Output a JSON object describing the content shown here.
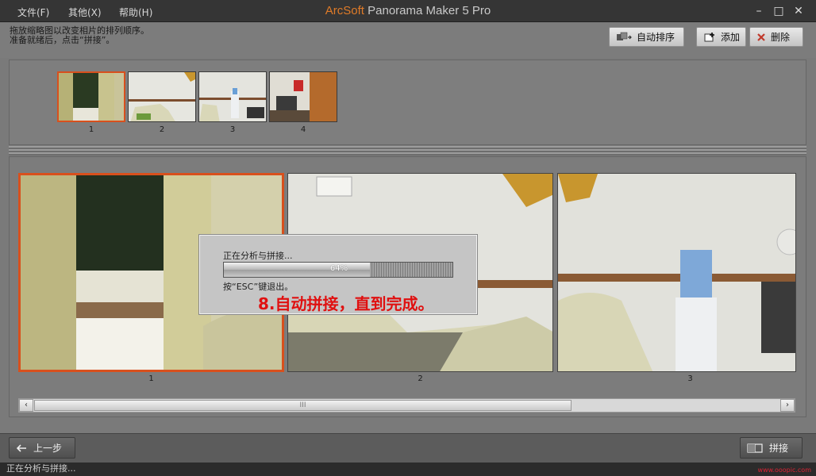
{
  "titlebar": {
    "menus": [
      "文件(F)",
      "其他(X)",
      "帮助(H)"
    ],
    "app_brand": "ArcSoft",
    "app_name": " Panorama Maker 5 Pro"
  },
  "toolbar": {
    "instruction_line1": "拖放缩略图以改变相片的排列顺序。",
    "instruction_line2": "准备就绪后，点击“拼接”。",
    "auto_sort_label": "自动排序",
    "add_label": "添加",
    "delete_label": "删除"
  },
  "thumbnails": [
    {
      "number": "1",
      "selected": true
    },
    {
      "number": "2",
      "selected": false
    },
    {
      "number": "3",
      "selected": false
    },
    {
      "number": "4",
      "selected": false
    }
  ],
  "photos": [
    {
      "number": "1",
      "selected": true
    },
    {
      "number": "2",
      "selected": false
    },
    {
      "number": "3",
      "selected": false
    }
  ],
  "scrollbar": {
    "grip": "III"
  },
  "progress": {
    "title": "正在分析与拼接...",
    "percent": 64,
    "percent_text": "64%",
    "hint": "按“ESC”键退出。",
    "step_note": "8.自动拼接，直到完成。"
  },
  "bottom": {
    "back_label": "上一步",
    "stitch_label": "拼接"
  },
  "status": {
    "text": "正在分析与拼接...",
    "watermark": "www.ooopic.com"
  },
  "colors": {
    "selection": "#d8501d",
    "step_note": "#e01010",
    "brand": "#e07b28"
  }
}
